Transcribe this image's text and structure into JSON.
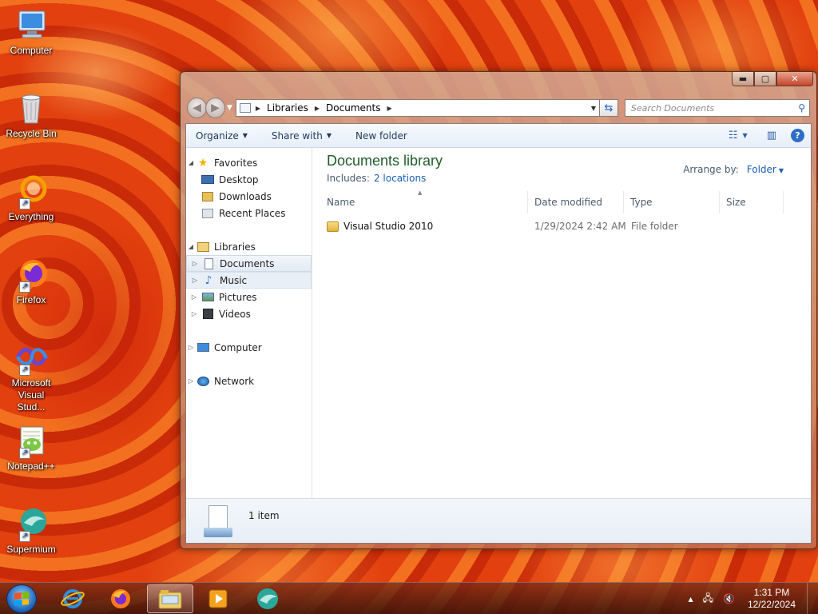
{
  "desktop": {
    "icons": [
      {
        "label": "Computer",
        "icon": "computer-icon"
      },
      {
        "label": "Recycle Bin",
        "icon": "recycle-bin-icon"
      },
      {
        "label": "Everything",
        "icon": "everything-icon"
      },
      {
        "label": "Firefox",
        "icon": "firefox-icon"
      },
      {
        "label": "Microsoft Visual Stud...",
        "icon": "visual-studio-icon"
      },
      {
        "label": "Notepad++",
        "icon": "notepad-plus-plus-icon"
      },
      {
        "label": "Supermium",
        "icon": "supermium-icon"
      }
    ]
  },
  "window": {
    "buttons": {
      "minimize": "▬",
      "maximize": "▢",
      "close": "✕"
    },
    "address": {
      "segments": [
        "Libraries",
        "Documents"
      ]
    },
    "search": {
      "placeholder": "Search Documents"
    },
    "toolbar": {
      "organize": "Organize",
      "share_with": "Share with",
      "new_folder": "New folder"
    },
    "nav_pane": {
      "favorites": "Favorites",
      "desktop": "Desktop",
      "downloads": "Downloads",
      "recent_places": "Recent Places",
      "libraries": "Libraries",
      "documents": "Documents",
      "music": "Music",
      "pictures": "Pictures",
      "videos": "Videos",
      "computer": "Computer",
      "network": "Network"
    },
    "content": {
      "title": "Documents library",
      "includes_label": "Includes:",
      "includes_link": "2 locations",
      "arrange_label": "Arrange by:",
      "arrange_value": "Folder",
      "columns": {
        "name": "Name",
        "date": "Date modified",
        "type": "Type",
        "size": "Size"
      },
      "rows": [
        {
          "name": "Visual Studio 2010",
          "date": "1/29/2024 2:42 AM",
          "type": "File folder",
          "size": ""
        }
      ]
    },
    "details": {
      "count": "1 item"
    }
  },
  "taskbar": {
    "pinned": [
      "internet-explorer-icon",
      "firefox-icon",
      "windows-explorer-icon",
      "media-player-icon",
      "supermium-icon"
    ],
    "clock": {
      "time": "1:31 PM",
      "date": "12/22/2024"
    }
  },
  "colors": {
    "title_green": "#1e5d2a",
    "link_blue": "#1a5fb4"
  }
}
